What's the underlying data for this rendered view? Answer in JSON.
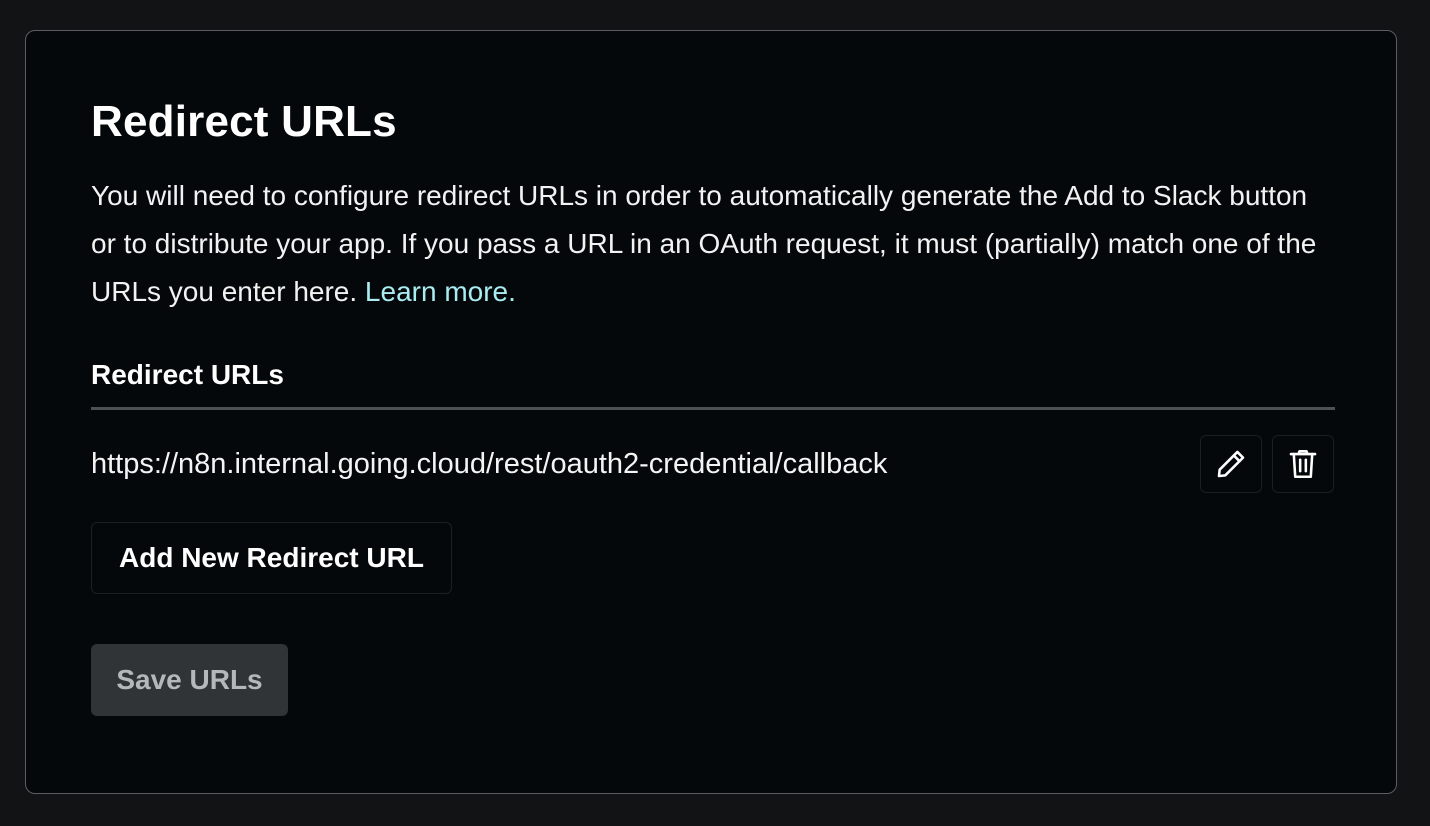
{
  "section": {
    "title": "Redirect URLs",
    "description": "You will need to configure redirect URLs in order to automatically generate the Add to Slack button or to distribute your app. If you pass a URL in an OAuth request, it must (partially) match one of the URLs you enter here.",
    "learn_more_label": "Learn more.",
    "list_label": "Redirect URLs"
  },
  "redirect_urls": [
    {
      "url": "https://n8n.internal.going.cloud/rest/oauth2-credential/callback",
      "edit_icon": "pencil-icon",
      "delete_icon": "trash-icon"
    }
  ],
  "buttons": {
    "add_label": "Add New Redirect URL",
    "save_label": "Save URLs",
    "save_disabled": true
  },
  "colors": {
    "link": "#a9ecf1",
    "panel_background": "#05080a",
    "page_background": "#111315",
    "save_button_background": "#303436"
  }
}
